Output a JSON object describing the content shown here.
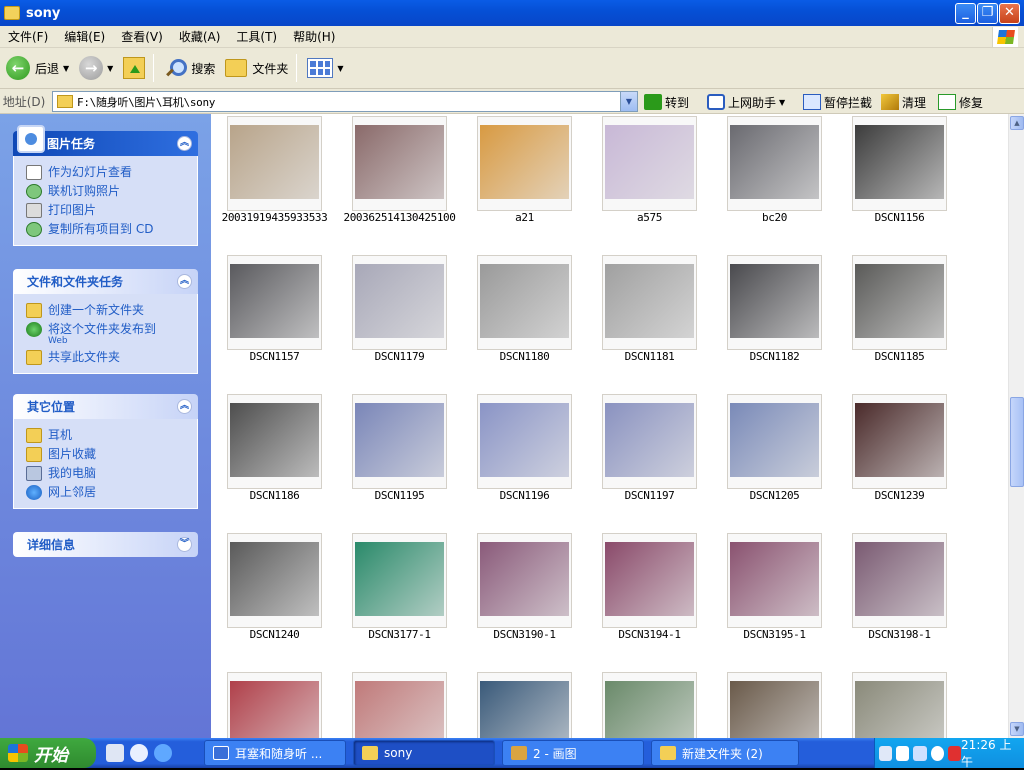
{
  "window": {
    "title": "sony"
  },
  "menu": [
    "文件(F)",
    "编辑(E)",
    "查看(V)",
    "收藏(A)",
    "工具(T)",
    "帮助(H)"
  ],
  "toolbar": {
    "back": "后退",
    "search": "搜索",
    "folders": "文件夹"
  },
  "address": {
    "label": "地址(D)",
    "value": "F:\\随身听\\图片\\耳机\\sony",
    "go": "转到",
    "assistant": "上网助手",
    "popup_block": "暂停拦截",
    "clean": "清理",
    "repair": "修复"
  },
  "sidebar": {
    "picture_tasks": {
      "title": "图片任务",
      "items": [
        "作为幻灯片查看",
        "联机订购照片",
        "打印图片",
        "复制所有项目到 CD"
      ]
    },
    "file_tasks": {
      "title": "文件和文件夹任务",
      "items": [
        {
          "label": "创建一个新文件夹"
        },
        {
          "label": "将这个文件夹发布到",
          "sub": "Web"
        },
        {
          "label": "共享此文件夹"
        }
      ]
    },
    "other_places": {
      "title": "其它位置",
      "items": [
        "耳机",
        "图片收藏",
        "我的电脑",
        "网上邻居"
      ]
    },
    "details": {
      "title": "详细信息"
    }
  },
  "files": [
    {
      "name": "20031919435933533",
      "color": "#b8a48a"
    },
    {
      "name": "200362514130425100",
      "color": "#8a6a6a"
    },
    {
      "name": "a21",
      "color": "#d89a42"
    },
    {
      "name": "a575",
      "color": "#c8b8d6"
    },
    {
      "name": "bc20",
      "color": "#6a6a70"
    },
    {
      "name": "DSCN1156",
      "color": "#3c3c3c"
    },
    {
      "name": "DSCN1157",
      "color": "#5a5a5e"
    },
    {
      "name": "DSCN1179",
      "color": "#a8a8b8"
    },
    {
      "name": "DSCN1180",
      "color": "#9a9a9a"
    },
    {
      "name": "DSCN1181",
      "color": "#a0a0a0"
    },
    {
      "name": "DSCN1182",
      "color": "#4a4a4e"
    },
    {
      "name": "DSCN1185",
      "color": "#5a5a58"
    },
    {
      "name": "DSCN1186",
      "color": "#4e4e4e"
    },
    {
      "name": "DSCN1195",
      "color": "#7a86b8"
    },
    {
      "name": "DSCN1196",
      "color": "#8a94c6"
    },
    {
      "name": "DSCN1197",
      "color": "#8a92c0"
    },
    {
      "name": "DSCN1205",
      "color": "#7a8ab8"
    },
    {
      "name": "DSCN1239",
      "color": "#4a2a2a"
    },
    {
      "name": "DSCN1240",
      "color": "#5a5a5a"
    },
    {
      "name": "DSCN3177-1",
      "color": "#2a8a6a"
    },
    {
      "name": "DSCN3190-1",
      "color": "#8a5a7a"
    },
    {
      "name": "DSCN3194-1",
      "color": "#8a4a6a"
    },
    {
      "name": "DSCN3195-1",
      "color": "#8a5270"
    },
    {
      "name": "DSCN3198-1",
      "color": "#7a5a72"
    },
    {
      "name": "",
      "color": "#b0404a"
    },
    {
      "name": "",
      "color": "#c07a7a"
    },
    {
      "name": "",
      "color": "#3a5a7a"
    },
    {
      "name": "",
      "color": "#6a8a6a"
    },
    {
      "name": "",
      "color": "#6a5a4a"
    },
    {
      "name": "",
      "color": "#8a8a7a"
    }
  ],
  "taskbar": {
    "start": "开始",
    "tasks": [
      "耳塞和随身听 ...",
      "sony",
      "2 - 画图",
      "新建文件夹 (2)"
    ],
    "clock": "21:26 上午"
  }
}
